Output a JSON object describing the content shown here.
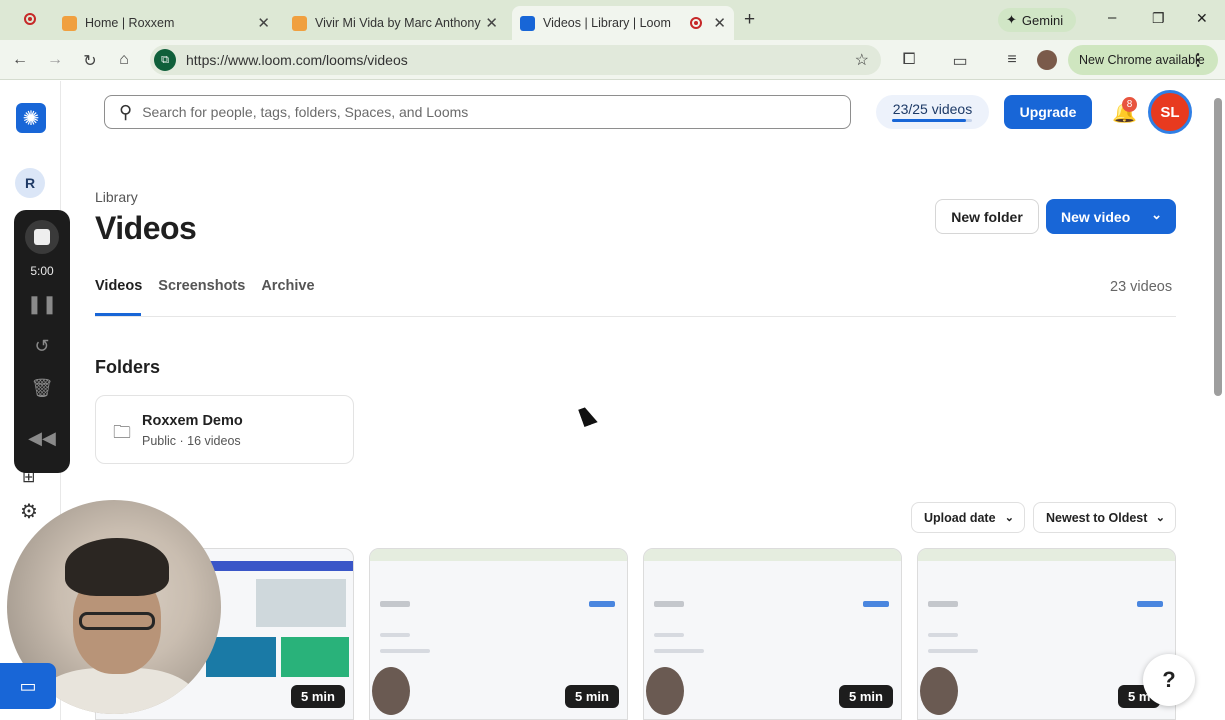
{
  "browser": {
    "tabs": [
      {
        "title": "Home | Roxxem",
        "active": false
      },
      {
        "title": "Vivir Mi Vida by Marc Anthony",
        "active": false
      },
      {
        "title": "Videos | Library | Loom",
        "active": true
      }
    ],
    "new_tab": "+",
    "gemini_label": "Gemini",
    "url": "https://www.loom.com/looms/videos",
    "chrome_update": "New Chrome available",
    "window": {
      "minimize": "–",
      "restore": "❐",
      "close": "✕"
    }
  },
  "header": {
    "search_placeholder": "Search for people, tags, folders, Spaces, and Looms",
    "quota": "23/25 videos",
    "quota_used_fraction": 0.92,
    "upgrade": "Upgrade",
    "notifications": "8",
    "user_initials": "SL"
  },
  "sidebar": {
    "workspace_initial": "R",
    "recording": {
      "time": "5:00"
    }
  },
  "main": {
    "breadcrumb": "Library",
    "title": "Videos",
    "new_folder": "New folder",
    "new_video": "New video",
    "tabs": [
      "Videos",
      "Screenshots",
      "Archive"
    ],
    "count": "23 videos",
    "folders_heading": "Folders",
    "folder": {
      "name": "Roxxem Demo",
      "meta": "Public · 16 videos"
    },
    "sort_by": "Upload date",
    "sort_order": "Newest to Oldest",
    "videos": [
      {
        "duration": "5 min"
      },
      {
        "duration": "5 min"
      },
      {
        "duration": "5 min"
      },
      {
        "duration": "5 m"
      }
    ]
  },
  "help": "?",
  "colors": {
    "brand": "#1866d7",
    "tab_bar": "#dde8d5",
    "avatar": "#e83a1f"
  }
}
